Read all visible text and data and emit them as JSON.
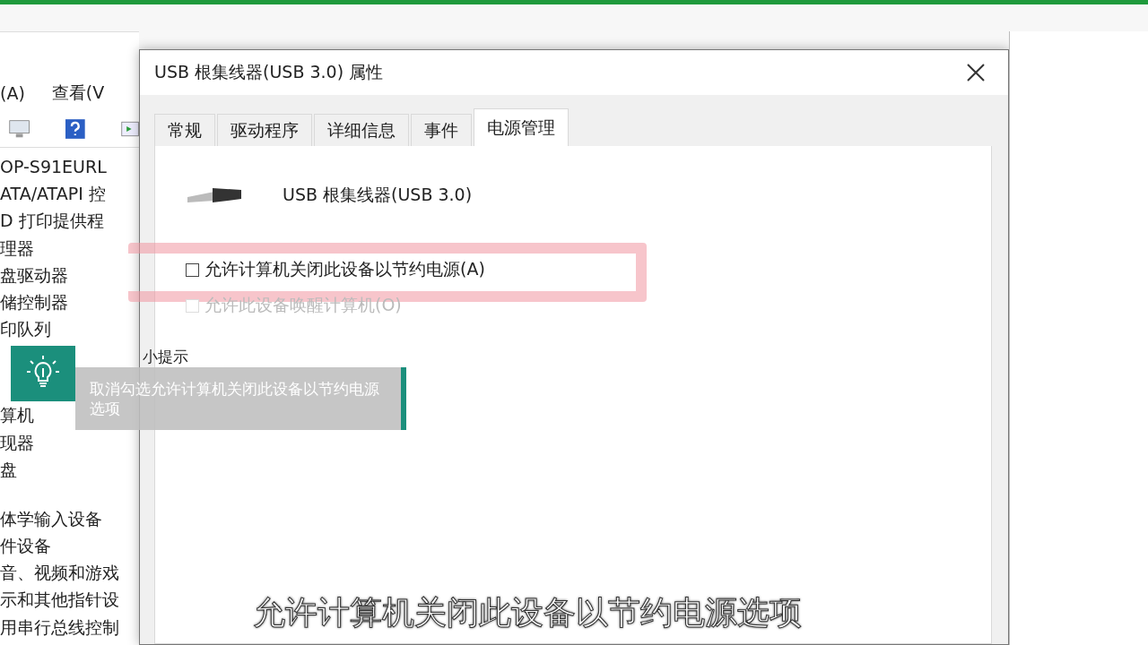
{
  "background_window": {
    "menu": [
      "(A)",
      "查看(V"
    ],
    "tree_groups": [
      [
        "OP-S91EURL",
        "ATA/ATAPI 控",
        "D 打印提供程",
        "理器",
        "盘驱动器",
        "储控制器",
        "印队列"
      ],
      [
        "算机",
        "现器",
        "盘"
      ],
      [
        "体学输入设备",
        "件设备",
        "音、视频和游戏",
        "示和其他指针设",
        "用串行总线控制"
      ]
    ]
  },
  "dialog": {
    "title": "USB 根集线器(USB 3.0) 属性",
    "tabs": [
      {
        "label": "常规",
        "selected": false
      },
      {
        "label": "驱动程序",
        "selected": false
      },
      {
        "label": "详细信息",
        "selected": false
      },
      {
        "label": "事件",
        "selected": false
      },
      {
        "label": "电源管理",
        "selected": true
      }
    ],
    "device_name": "USB 根集线器(USB 3.0)",
    "options": [
      {
        "label": "允许计算机关闭此设备以节约电源(A)",
        "checked": false,
        "disabled": false,
        "highlighted": true
      },
      {
        "label": "允许此设备唤醒计算机(O)",
        "checked": false,
        "disabled": true,
        "highlighted": false
      }
    ]
  },
  "tip": {
    "title": "小提示",
    "text": "取消勾选允许计算机关闭此设备以节约电源选项"
  },
  "subtitle": "允许计算机关闭此设备以节约电源选项"
}
